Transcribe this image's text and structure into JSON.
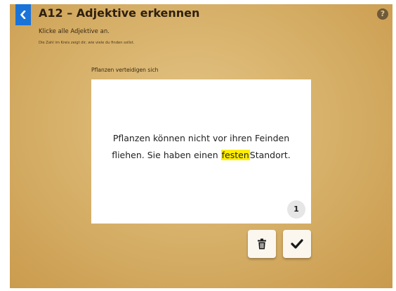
{
  "header": {
    "title": "A12 – Adjektive erkennen",
    "instruction": "Klicke alle Adjektive an.",
    "hint": "Die Zahl im Kreis zeigt dir, wie viele du finden sollst."
  },
  "exercise": {
    "caption": "Pflanzen verteidigen sich",
    "line1": [
      "Pflanzen",
      "können",
      "nicht",
      "vor",
      "ihren",
      "Feinden"
    ],
    "line2": [
      "fliehen.",
      "Sie",
      "haben",
      "einen",
      "festen",
      "Standort."
    ],
    "highlighted_word": "festen",
    "remaining_count": "1"
  },
  "icons": {
    "back": "chevron-left-icon",
    "help": "question-mark-icon",
    "delete": "trash-icon",
    "check": "checkmark-icon"
  },
  "colors": {
    "background": "#d9b46e",
    "back_button": "#1a73d9",
    "highlight": "#ffee00",
    "title_text": "#2e2010"
  }
}
